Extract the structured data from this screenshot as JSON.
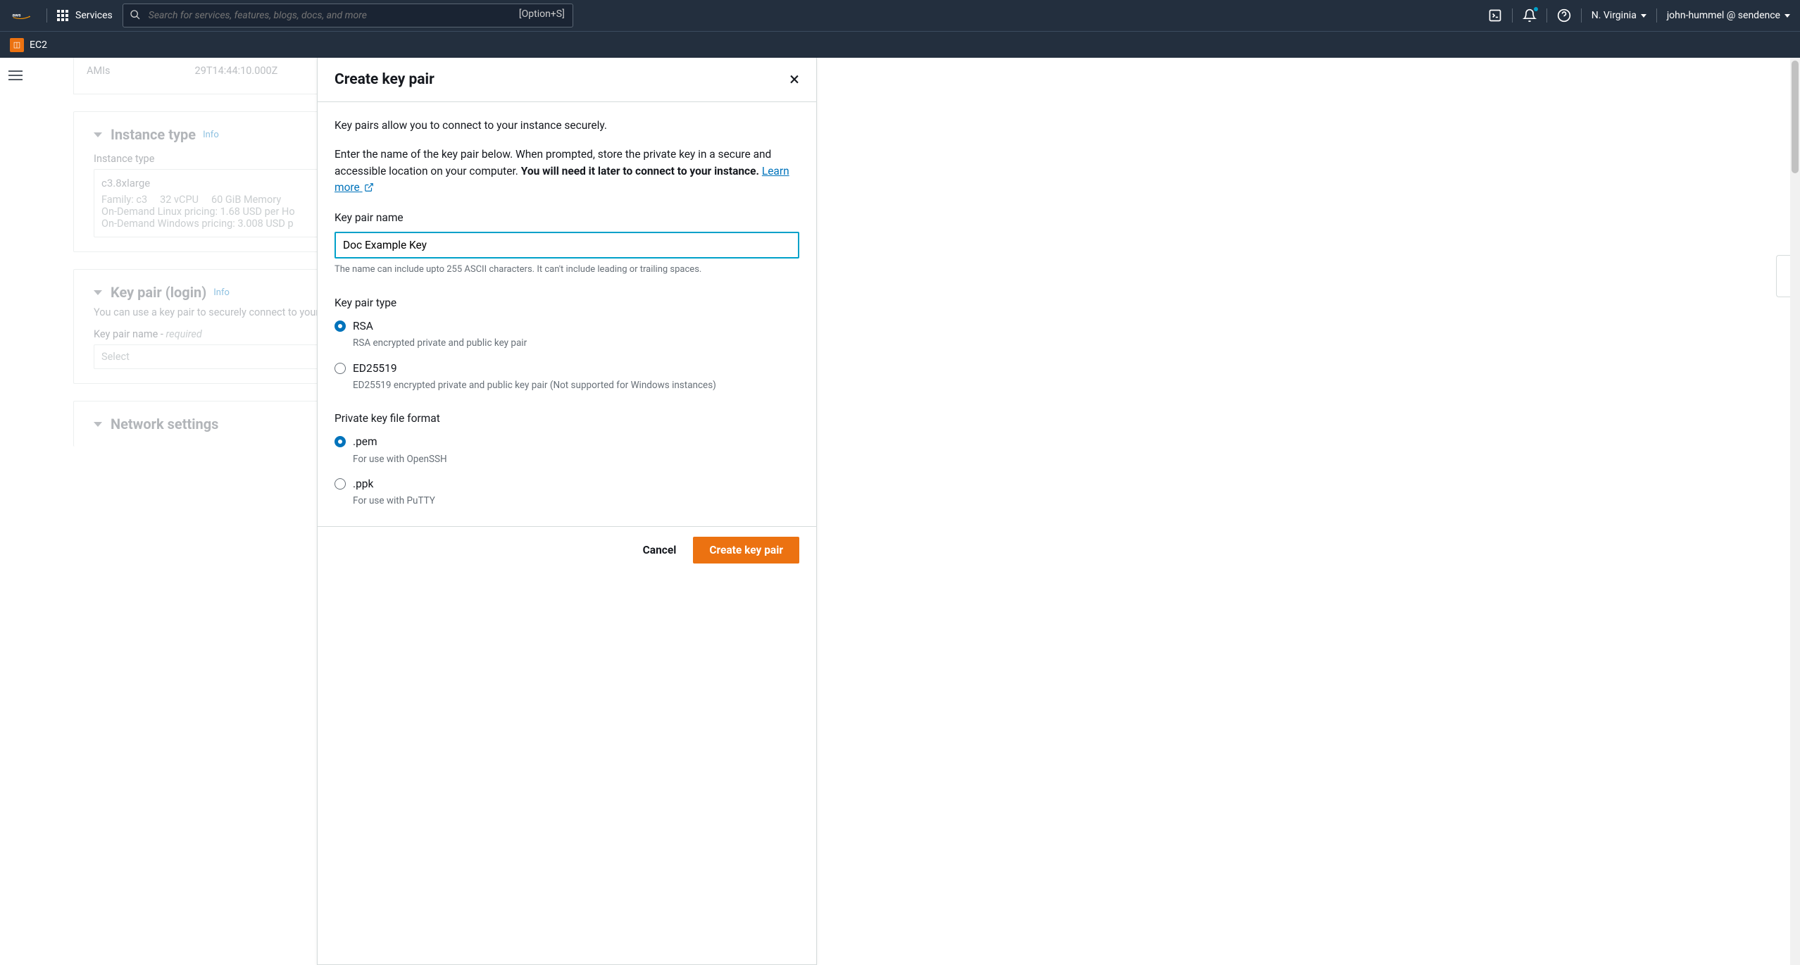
{
  "nav": {
    "services_label": "Services",
    "search_placeholder": "Search for services, features, blogs, docs, and more",
    "search_hotkey": "[Option+S]",
    "region": "N. Virginia",
    "account": "john-hummel @ sendence",
    "service_name": "EC2"
  },
  "bg": {
    "amis_label": "AMIs",
    "amis_timestamp": "29T14:44:10.000Z",
    "instance_type_header": "Instance type",
    "info": "Info",
    "instance_type_label": "Instance type",
    "instance_value": "c3.8xlarge",
    "spec_family": "Family: c3",
    "spec_vcpu": "32 vCPU",
    "spec_mem": "60 GiB Memory",
    "price_linux": "On-Demand Linux pricing: 1.68 USD per Ho",
    "price_windows": "On-Demand Windows pricing: 3.008 USD p",
    "keypair_header": "Key pair (login)",
    "keypair_desc": "You can use a key pair to securely connect to your instance.",
    "keypair_name_label": "Key pair name - ",
    "required": "required",
    "select_placeholder": "Select",
    "network_header": "Network settings"
  },
  "modal": {
    "title": "Create key pair",
    "intro": "Key pairs allow you to connect to your instance securely.",
    "desc_prefix": "Enter the name of the key pair below. When prompted, store the private key in a secure and accessible location on your computer. ",
    "desc_bold": "You will need it later to connect to your instance.",
    "learn_more": "Learn more",
    "name_label": "Key pair name",
    "name_value": "Doc Example Key",
    "name_hint": "The name can include upto 255 ASCII characters. It can't include leading or trailing spaces.",
    "type_label": "Key pair type",
    "type_rsa": "RSA",
    "type_rsa_desc": "RSA encrypted private and public key pair",
    "type_ed": "ED25519",
    "type_ed_desc": "ED25519 encrypted private and public key pair (Not supported for Windows instances)",
    "format_label": "Private key file format",
    "fmt_pem": ".pem",
    "fmt_pem_desc": "For use with OpenSSH",
    "fmt_ppk": ".ppk",
    "fmt_ppk_desc": "For use with PuTTY",
    "cancel": "Cancel",
    "submit": "Create key pair"
  }
}
